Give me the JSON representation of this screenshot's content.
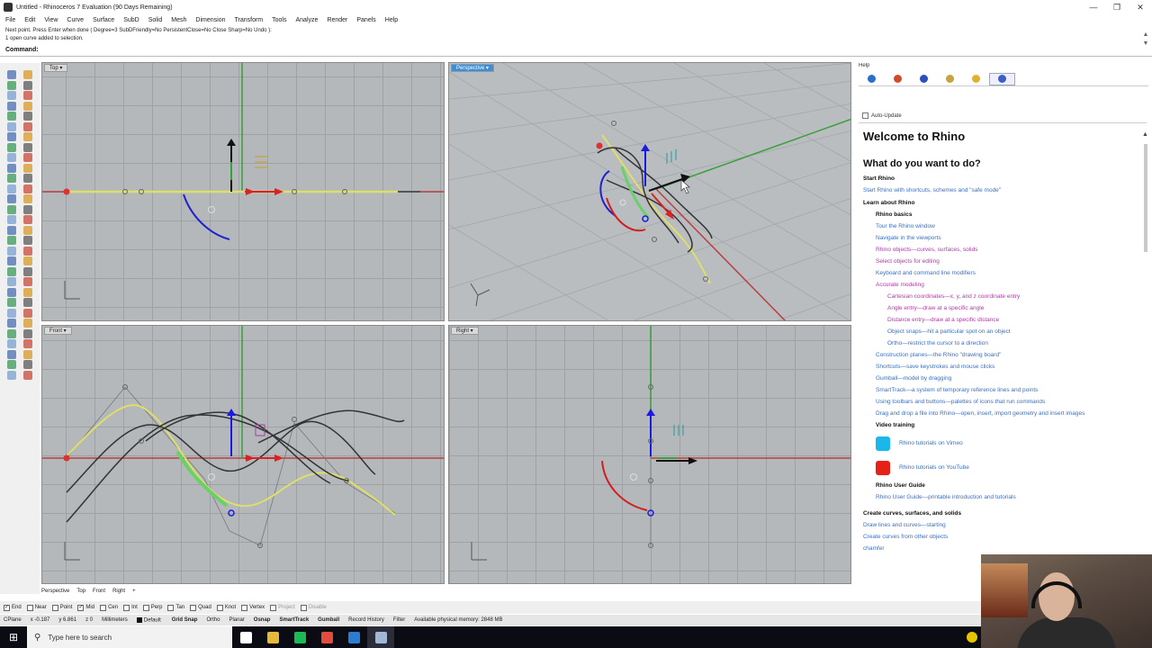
{
  "window": {
    "title": "Untitled - Rhinoceros 7 Evaluation (90 Days Remaining)",
    "controls": [
      "—",
      "❐",
      "✕"
    ]
  },
  "menu": [
    "File",
    "Edit",
    "View",
    "Curve",
    "Surface",
    "SubD",
    "Solid",
    "Mesh",
    "Dimension",
    "Transform",
    "Tools",
    "Analyze",
    "Render",
    "Panels",
    "Help"
  ],
  "command": {
    "history": [
      "Next point. Press Enter when done ( Degree=3  SubDFriendly=No  PersistentClose=No  Close  Sharp=No  Undo ):",
      "1 open curve added to selection."
    ],
    "prompt": "Command:"
  },
  "viewports": {
    "top": "Top",
    "perspective": "Perspective",
    "front": "Front",
    "right": "Right"
  },
  "viewport_tabs": [
    "Perspective",
    "Top",
    "Front",
    "Right",
    "+"
  ],
  "osnaps": [
    {
      "label": "End",
      "checked": true
    },
    {
      "label": "Near",
      "checked": false
    },
    {
      "label": "Point",
      "checked": false
    },
    {
      "label": "Mid",
      "checked": true
    },
    {
      "label": "Cen",
      "checked": false
    },
    {
      "label": "Int",
      "checked": false
    },
    {
      "label": "Perp",
      "checked": false
    },
    {
      "label": "Tan",
      "checked": false
    },
    {
      "label": "Quad",
      "checked": false
    },
    {
      "label": "Knot",
      "checked": false
    },
    {
      "label": "Vertex",
      "checked": false
    },
    {
      "label": "Project",
      "checked": false,
      "disabled": true
    },
    {
      "label": "Disable",
      "checked": false,
      "disabled": true
    }
  ],
  "status": {
    "cplane": "CPlane",
    "x": "x -0.187",
    "y": "y 6.861",
    "z": "z 0",
    "units": "Millimeters",
    "layer": "Default",
    "panes": [
      {
        "label": "Grid Snap",
        "bold": true
      },
      {
        "label": "Ortho",
        "bold": false
      },
      {
        "label": "Planar",
        "bold": false
      },
      {
        "label": "Osnap",
        "bold": true
      },
      {
        "label": "SmartTrack",
        "bold": true
      },
      {
        "label": "Gumball",
        "bold": true
      },
      {
        "label": "Record History",
        "bold": false
      },
      {
        "label": "Filter",
        "bold": false
      },
      {
        "label": "Available physical memory: 2848 MB",
        "bold": false
      }
    ]
  },
  "panel": {
    "title": "Help",
    "tab_icon_colors": [
      "#2a6fcc",
      "#d24a2a",
      "#2a4fbf",
      "#c8a23a",
      "#e0b030",
      "#3a5fc8"
    ],
    "auto_update": "Auto-Update",
    "help": {
      "heading": "Welcome to Rhino",
      "subheading": "What do you want to do?",
      "start_title": "Start Rhino",
      "start_link": "Start Rhino with shortcuts, schemes and \"safe mode\"",
      "learn_title": "Learn about Rhino",
      "basics_title": "Rhino basics",
      "basics": [
        {
          "text": "Tour the Rhino window",
          "visited": false
        },
        {
          "text": "Navigate in the viewports",
          "visited": false
        },
        {
          "text": "Rhino objects—curves, surfaces, solids",
          "visited": true
        },
        {
          "text": "Select objects for editing",
          "visited": true
        },
        {
          "text": "Keyboard and command line modifiers",
          "visited": false
        },
        {
          "text": "Accurate modeling",
          "visited": true
        }
      ],
      "accurate": [
        {
          "text": "Cartesian coordinates—x, y, and z coordinate entry",
          "visited": true
        },
        {
          "text": "Angle entry—draw at a specific angle",
          "visited": true
        },
        {
          "text": "Distance entry—draw at a specific distance",
          "visited": true
        },
        {
          "text": "Object snaps—hit a particular spot on an object",
          "visited": false
        },
        {
          "text": "Ortho—restrict the cursor to a direction",
          "visited": false
        }
      ],
      "more": [
        "Construction planes—the Rhino \"drawing board\"",
        "Shortcuts—save keystrokes and mouse clicks",
        "Gumball—model by dragging",
        "SmartTrack—a system of temporary reference lines and points",
        "Using toolbars and buttons—palettes of icons that run commands",
        "Drag and drop a file into Rhino—open, insert, import geometry and insert images"
      ],
      "video_title": "Video training",
      "videos": [
        {
          "text": "Rhino tutorials on Vimeo",
          "color": "#1ab7ea"
        },
        {
          "text": "Rhino tutorials on YouTube",
          "color": "#e62117"
        }
      ],
      "guide_title": "Rhino User Guide",
      "guide_link": "Rhino User Guide—printable introduction and tutorials",
      "create_title": "Create curves, surfaces, and solids",
      "create": [
        "Draw lines and curves—starting",
        "Create curves from other objects",
        "chamfer"
      ]
    }
  },
  "taskbar": {
    "search_placeholder": "Type here to search",
    "apps": [
      {
        "name": "task-view",
        "color": "#ffffff",
        "active": false
      },
      {
        "name": "file-explorer",
        "color": "#e8b83a",
        "active": false
      },
      {
        "name": "spotify",
        "color": "#1db954",
        "active": false
      },
      {
        "name": "chrome",
        "color": "#e34b3a",
        "active": false
      },
      {
        "name": "mail",
        "color": "#2b7cd3",
        "active": false
      },
      {
        "name": "rhino",
        "color": "#9fb8d8",
        "active": true
      }
    ]
  },
  "colors": {
    "x_axis": "#b84040",
    "y_axis": "#3aa03a",
    "curve_yellow": "#dede6a",
    "arc_blue": "#2222cc",
    "arc_red": "#d02020",
    "green_surface": "#6ad06a",
    "gumball_blue": "#1a1ae0",
    "gumball_red": "#e02020"
  }
}
